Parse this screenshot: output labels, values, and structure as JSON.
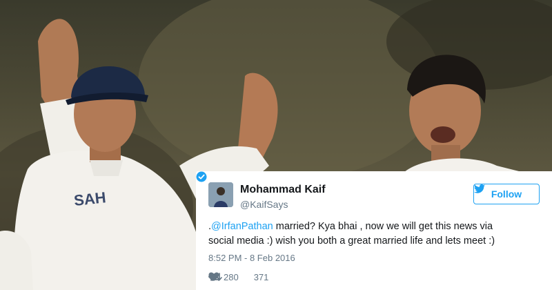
{
  "tweet": {
    "display_name": "Mohammad Kaif",
    "handle": "@KaifSays",
    "follow_label": "Follow",
    "text_prefix": ".",
    "mention": "@IrfanPathan",
    "text_line1_rest": " married? Kya bhai , now we will get this news via",
    "text_line2": "social media :) wish you both a great married life and lets meet :)",
    "timestamp": "8:52 PM - 8 Feb 2016",
    "retweets": "280",
    "likes": "371"
  },
  "photo": {
    "jersey_text": "SAH"
  },
  "colors": {
    "twitter_blue": "#1da1f2",
    "text_dark": "#14171a",
    "text_muted": "#657786",
    "cap_navy": "#1c2a45"
  }
}
